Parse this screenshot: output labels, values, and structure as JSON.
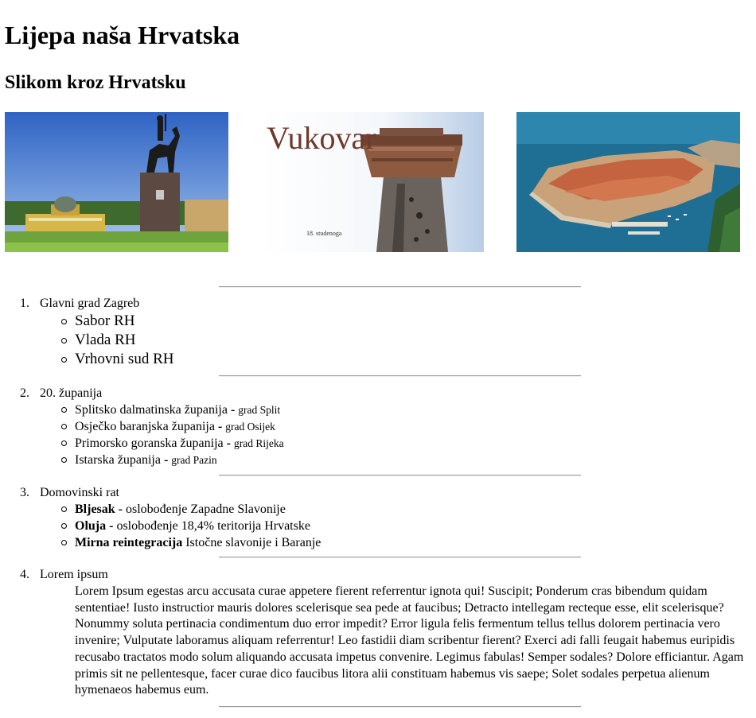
{
  "page": {
    "title": "Lijepa naša Hrvatska",
    "subtitle": "Slikom kroz Hrvatsku"
  },
  "gallery": {
    "vukovar_caption": "Vukovar",
    "vukovar_date": "18. studenoga"
  },
  "sections": [
    {
      "number": "1.",
      "title": "Glavni grad Zagreb",
      "items": [
        "Sabor RH",
        "Vlada RH",
        "Vrhovni sud RH"
      ]
    },
    {
      "number": "2.",
      "title": "20. županija",
      "items": [
        {
          "name": "Splitsko dalmatinska županija",
          "sep": " - ",
          "city": "grad Split"
        },
        {
          "name": "Osječko baranjska županija",
          "sep": " - ",
          "city": "grad Osijek"
        },
        {
          "name": "Primorsko goranska županija",
          "sep": " - ",
          "city": "grad Rijeka"
        },
        {
          "name": "Istarska županija",
          "sep": " - ",
          "city": "grad Pazin"
        }
      ]
    },
    {
      "number": "3.",
      "title": "Domovinski rat",
      "items": [
        {
          "strong": "Bljesak -",
          "text": " oslobođenje Zapadne Slavonije"
        },
        {
          "strong": "Oluja -",
          "text": " oslobođenje 18,4% teritorija Hrvatske"
        },
        {
          "strong": "Mirna reintegracija",
          "text": " Istočne slavonije i Baranje"
        }
      ]
    },
    {
      "number": "4.",
      "title": "Lorem ipsum",
      "text": "Lorem Ipsum egestas arcu accusata curae appetere fierent referrentur ignota qui! Suscipit; Ponderum cras bibendum quidam sententiae! Iusto instructior mauris dolores scelerisque sea pede at faucibus; Detracto intellegam recteque esse, elit scelerisque? Nonummy soluta pertinacia condimentum duo error impedit? Error ligula felis fermentum tellus tellus dolorem pertinacia vero invenire; Vulputate laboramus aliquam referrentur! Leo fastidii diam scribentur fierent? Exerci adi falli feugait habemus euripidis recusabo tractatos modo solum aliquando accusata impetus convenire. Legimus fabulas! Semper sodales? Dolore efficiantur. Agam primis sit ne pellentesque, facer curae dico faucibus litora alii constituam habemus vis saepe; Solet sodales perpetua alienum hymenaeos habemus eum."
    }
  ]
}
